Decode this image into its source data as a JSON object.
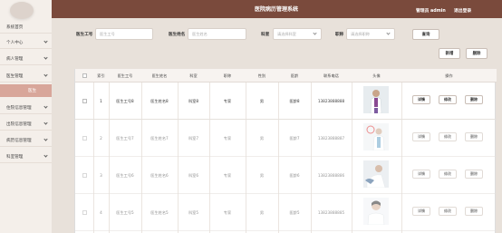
{
  "header": {
    "title": "医院病历管理系统",
    "admin": "管理员 admin",
    "logout": "退出登录"
  },
  "sidebar": {
    "items": [
      {
        "label": "系统首页",
        "chevron": false
      },
      {
        "label": "个人中心",
        "chevron": true
      },
      {
        "label": "病人管理",
        "chevron": true
      },
      {
        "label": "医生管理",
        "chevron": true
      },
      {
        "label": "医生",
        "sub": true
      },
      {
        "label": "住院信息管理",
        "chevron": true
      },
      {
        "label": "出院信息管理",
        "chevron": true
      },
      {
        "label": "病历信息管理",
        "chevron": true
      },
      {
        "label": "科室管理",
        "chevron": true
      }
    ]
  },
  "search": {
    "doctor_no_label": "医生工号",
    "doctor_no_placeholder": "医生工号",
    "doctor_name_label": "医生姓名",
    "doctor_name_placeholder": "医生姓名",
    "dept_label": "科室",
    "dept_placeholder": "请选择科室",
    "title_label": "职称",
    "title_placeholder": "请选择职称",
    "search_button": "查询"
  },
  "actions": {
    "add": "新增",
    "delete": "删除"
  },
  "table": {
    "headers": [
      "索引",
      "医生工号",
      "医生姓名",
      "科室",
      "职称",
      "性别",
      "医龄",
      "联系电话",
      "头像",
      "操作"
    ],
    "rows": [
      {
        "index": "1",
        "no": "医生工号8",
        "name": "医生姓名8",
        "dept": "科室8",
        "title": "专家",
        "gender": "男",
        "years": "医龄8",
        "phone": "13823888888"
      },
      {
        "index": "2",
        "no": "医生工号7",
        "name": "医生姓名7",
        "dept": "科室7",
        "title": "专家",
        "gender": "男",
        "years": "医龄7",
        "phone": "13823888887"
      },
      {
        "index": "3",
        "no": "医生工号6",
        "name": "医生姓名6",
        "dept": "科室6",
        "title": "专家",
        "gender": "男",
        "years": "医龄6",
        "phone": "13823888886"
      },
      {
        "index": "4",
        "no": "医生工号5",
        "name": "医生姓名5",
        "dept": "科室5",
        "title": "专家",
        "gender": "男",
        "years": "医龄5",
        "phone": "13823888885"
      }
    ],
    "ops": {
      "detail": "详情",
      "edit": "修改",
      "delete": "删除"
    }
  },
  "colors": {
    "header": "#7a4a3c",
    "sidebar_active": "#d8a69a",
    "background": "#e8e1da"
  }
}
